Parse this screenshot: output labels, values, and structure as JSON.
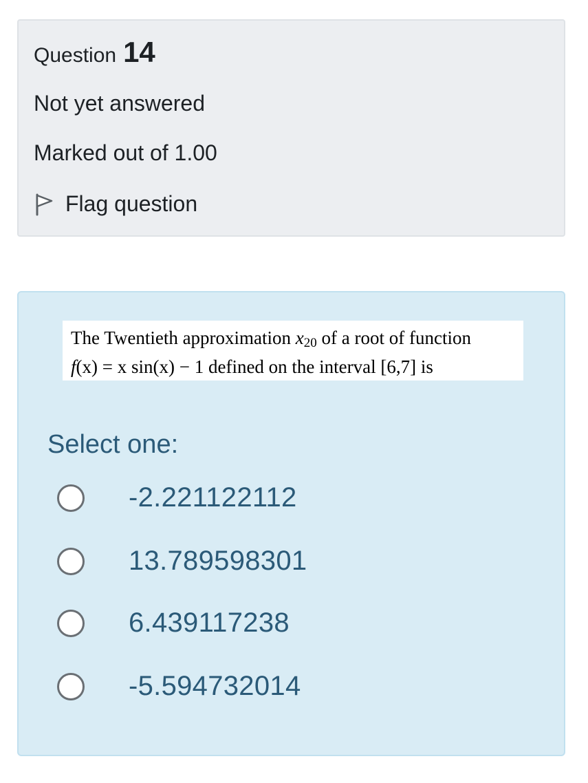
{
  "question_info": {
    "label": "Question",
    "number": "14",
    "state": "Not yet answered",
    "grade": "Marked out of 1.00",
    "flag": {
      "icon": "flag-icon",
      "label": "Flag question"
    }
  },
  "question": {
    "text_line1_a": "The Twentieth approximation ",
    "var_x": "x",
    "var_sub": "20",
    "text_line1_b": " of a root of function",
    "line2_func": "f",
    "line2_math_a": "(x) = x ",
    "line2_sin": "sin",
    "line2_math_b": "(x) − 1",
    "line2_text": "  defined on the interval [6,7]  is"
  },
  "answer": {
    "prompt": "Select one:",
    "options": [
      {
        "label": "-2.221122112",
        "selected": false
      },
      {
        "label": "13.789598301",
        "selected": false
      },
      {
        "label": "6.439117238",
        "selected": false
      },
      {
        "label": "-5.594732014",
        "selected": false
      }
    ]
  },
  "colors": {
    "info_bg": "#eceef1",
    "content_bg": "#d9ecf5",
    "answer_text": "#2b5a78"
  }
}
